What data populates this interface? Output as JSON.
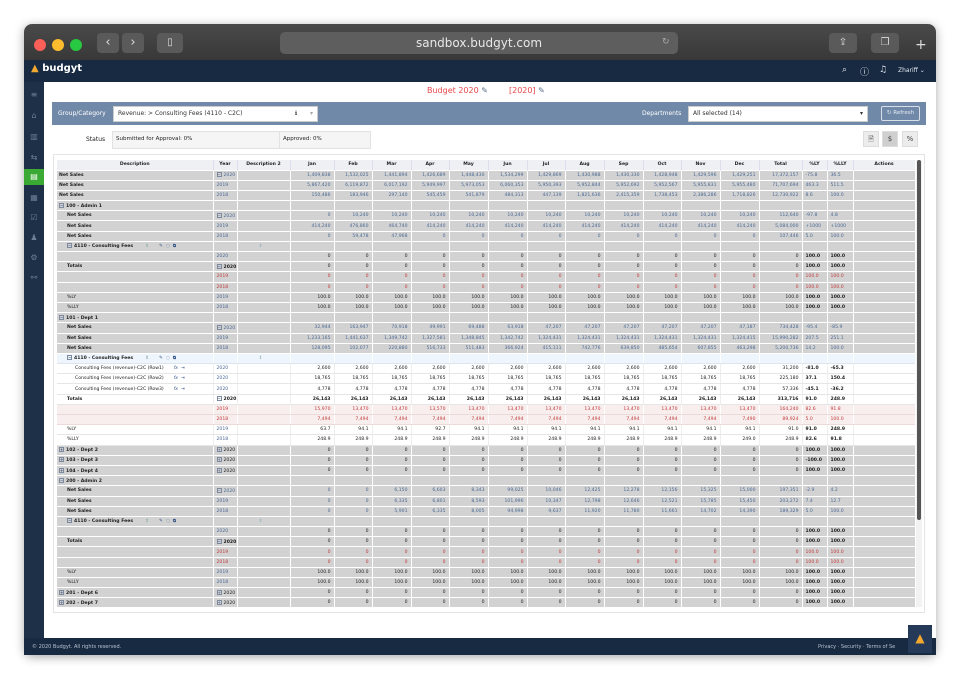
{
  "browser": {
    "url": "sandbox.budgyt.com"
  },
  "app": {
    "logo": "budgyt",
    "user": "Zhariff",
    "icons": [
      "search-icon",
      "help-icon",
      "bell-icon"
    ]
  },
  "sidebar": {
    "items": [
      "menu-icon",
      "home-icon",
      "reports-icon",
      "transfer-icon",
      "budget-icon",
      "documents-icon",
      "approvals-icon",
      "users-icon",
      "settings-icon",
      "integrations-icon"
    ],
    "active": 4,
    "active_color": "#3aaa35"
  },
  "header": {
    "budget": "Budget 2020",
    "year": "[2020]"
  },
  "filter": {
    "group_label": "Group/Category",
    "group_value": "Revenue: > Consulting Fees (4110 - C2C)",
    "departments_label": "Departments",
    "departments_value": "All selected (14)",
    "refresh": "Refresh"
  },
  "status": {
    "label": "Status",
    "submitted": "Submitted for Approval: 0%",
    "approved": "Approved: 0%",
    "buttons": [
      "$",
      "%"
    ]
  },
  "table": {
    "columns": [
      "Description",
      "Year",
      "Description 2",
      "Jan",
      "Feb",
      "Mar",
      "Apr",
      "May",
      "Jun",
      "Jul",
      "Aug",
      "Sep",
      "Oct",
      "Nov",
      "Dec",
      "Total",
      "%LY",
      "%LLY",
      "Actions"
    ],
    "rows": [
      {
        "d": "Net Sales",
        "l": 0,
        "b": 1,
        "y": "2020",
        "yt": "minus",
        "c": "blue",
        "v": [
          "1,409,838",
          "1,532,025",
          "1,441,894",
          "1,426,689",
          "1,448,430",
          "1,534,299",
          "1,429,869",
          "1,430,988",
          "1,430,330",
          "1,428,948",
          "1,429,596",
          "1,429,251"
        ],
        "t": "17,372,157",
        "ly": "-75.8",
        "lly": "36.5",
        "bg": "gray"
      },
      {
        "d": "Net Sales",
        "l": 0,
        "b": 1,
        "y": "2019",
        "c": "blue",
        "v": [
          "5,867,420",
          "6,119,872",
          "6,017,192",
          "5,949,997",
          "5,973,053",
          "6,060,353",
          "5,950,393",
          "5,952,844",
          "5,952,692",
          "5,952,567",
          "5,955,831",
          "5,955,480"
        ],
        "t": "71,707,694",
        "ly": "463.3",
        "lly": "511.5",
        "bg": "gray"
      },
      {
        "d": "Net Sales",
        "l": 0,
        "b": 1,
        "y": "2018",
        "c": "blue",
        "v": [
          "150,486",
          "183,946",
          "297,140",
          "545,459",
          "541,879",
          "484,313",
          "447,139",
          "1,821,636",
          "2,415,359",
          "1,738,453",
          "2,386,286",
          "1,718,826"
        ],
        "t": "12,730,922",
        "ly": "8.6",
        "lly": "100.0",
        "bg": "gray"
      },
      {
        "d": "100 - Admin 1",
        "l": 0,
        "b": 1,
        "tog": "minus",
        "bg": "gray"
      },
      {
        "d": "Net Sales",
        "l": 1,
        "b": 1,
        "y": "2020",
        "yt": "minus",
        "c": "blue",
        "v": [
          "0",
          "10,240",
          "10,240",
          "10,240",
          "10,240",
          "10,240",
          "10,240",
          "10,240",
          "10,240",
          "10,240",
          "10,240",
          "10,240"
        ],
        "t": "112,640",
        "ly": "-97.8",
        "lly": "4.8",
        "bg": "gray"
      },
      {
        "d": "Net Sales",
        "l": 1,
        "b": 1,
        "y": "2019",
        "c": "blue",
        "v": [
          "414,240",
          "476,860",
          "464,740",
          "414,240",
          "414,240",
          "414,240",
          "414,240",
          "414,240",
          "414,240",
          "414,240",
          "414,240",
          "414,240"
        ],
        "t": "5,084,000",
        "ly": "+1000",
        "lly": "+1000",
        "bg": "gray"
      },
      {
        "d": "Net Sales",
        "l": 1,
        "b": 1,
        "y": "2018",
        "c": "blue",
        "v": [
          "0",
          "59,478",
          "47,968",
          "0",
          "0",
          "0",
          "0",
          "0",
          "0",
          "0",
          "0",
          "0"
        ],
        "t": "107,446",
        "ly": "5.0",
        "lly": "100.0",
        "bg": "gray"
      },
      {
        "d": "4110 - Consulting Fees",
        "l": 1,
        "b": 1,
        "tog": "minus",
        "grp": 1,
        "bg": "gray"
      },
      {
        "d": "",
        "l": 1,
        "y": "2020",
        "c": "blk",
        "v": [
          "0",
          "0",
          "0",
          "0",
          "0",
          "0",
          "0",
          "0",
          "0",
          "0",
          "0",
          "0"
        ],
        "t": "0",
        "ly": "100.0",
        "lly": "100.0",
        "pb": 1,
        "bg": "gray"
      },
      {
        "d": "Totals",
        "l": 1,
        "b": 1,
        "y": "2020",
        "yt": "minus",
        "c": "blk",
        "v": [
          "0",
          "0",
          "0",
          "0",
          "0",
          "0",
          "0",
          "0",
          "0",
          "0",
          "0",
          "0"
        ],
        "t": "0",
        "ly": "100.0",
        "lly": "100.0",
        "pb": 1,
        "bg": "gray"
      },
      {
        "d": "",
        "l": 1,
        "y": "2019",
        "c": "red",
        "v": [
          "0",
          "0",
          "0",
          "0",
          "0",
          "0",
          "0",
          "0",
          "0",
          "0",
          "0",
          "0"
        ],
        "t": "0",
        "ly": "100.0",
        "lly": "100.0",
        "bg": "gray"
      },
      {
        "d": "",
        "l": 1,
        "y": "2018",
        "c": "red",
        "v": [
          "0",
          "0",
          "0",
          "0",
          "0",
          "0",
          "0",
          "0",
          "0",
          "0",
          "0",
          "0"
        ],
        "t": "0",
        "ly": "100.0",
        "lly": "100.0",
        "bg": "gray"
      },
      {
        "d": "%LY",
        "l": 1,
        "y": "2019",
        "c": "blk",
        "v": [
          "100.0",
          "100.0",
          "100.0",
          "100.0",
          "100.0",
          "100.0",
          "100.0",
          "100.0",
          "100.0",
          "100.0",
          "100.0",
          "100.0"
        ],
        "t": "100.0",
        "ly": "100.0",
        "lly": "100.0",
        "pb": 1,
        "bg": "gray"
      },
      {
        "d": "%LLY",
        "l": 1,
        "y": "2018",
        "c": "blk",
        "v": [
          "100.0",
          "100.0",
          "100.0",
          "100.0",
          "100.0",
          "100.0",
          "100.0",
          "100.0",
          "100.0",
          "100.0",
          "100.0",
          "100.0"
        ],
        "t": "100.0",
        "ly": "100.0",
        "lly": "100.0",
        "pb": 1,
        "bg": "gray"
      },
      {
        "d": "101 - Dept 1",
        "l": 0,
        "b": 1,
        "tog": "minus",
        "bg": "gray"
      },
      {
        "d": "Net Sales",
        "l": 1,
        "b": 1,
        "y": "2020",
        "yt": "minus",
        "c": "blue",
        "v": [
          "32,944",
          "163,947",
          "70,918",
          "49,991",
          "69,488",
          "63,918",
          "47,207",
          "47,207",
          "47,207",
          "47,207",
          "47,207",
          "47,187"
        ],
        "t": "734,428",
        "ly": "-95.4",
        "lly": "-85.9",
        "bg": "gray"
      },
      {
        "d": "Net Sales",
        "l": 1,
        "b": 1,
        "y": "2019",
        "c": "blue",
        "v": [
          "1,233,165",
          "1,441,637",
          "1,349,742",
          "1,327,581",
          "1,348,845",
          "1,342,742",
          "1,324,431",
          "1,324,431",
          "1,324,431",
          "1,324,431",
          "1,324,431",
          "1,324,415"
        ],
        "t": "15,990,282",
        "ly": "207.5",
        "lly": "251.1",
        "bg": "gray"
      },
      {
        "d": "Net Sales",
        "l": 1,
        "b": 1,
        "y": "2018",
        "c": "blue",
        "v": [
          "128,095",
          "102,077",
          "220,880",
          "516,733",
          "511,483",
          "366,924",
          "415,111",
          "742,776",
          "639,850",
          "485,654",
          "607,855",
          "463,298"
        ],
        "t": "5,200,736",
        "ly": "14.2",
        "lly": "100.0",
        "bg": "gray"
      },
      {
        "d": "4110 - Consulting Fees",
        "l": 1,
        "b": 1,
        "tog": "minus",
        "grp": 1,
        "bg": "lblue"
      },
      {
        "d": "Consulting Fees (revenue)-C2C (Row1)",
        "l": 2,
        "item": 1,
        "y": "2020",
        "c": "blk",
        "v": [
          "2,600",
          "2,600",
          "2,600",
          "2,600",
          "2,600",
          "2,600",
          "2,600",
          "2,600",
          "2,600",
          "2,600",
          "2,600",
          "2,600"
        ],
        "t": "31,200",
        "ly": "-81.0",
        "lly": "-65.3",
        "pb": 1,
        "bg": "white"
      },
      {
        "d": "Consulting Fees (revenue)-C2C (Row2)",
        "l": 2,
        "item": 1,
        "y": "2020",
        "c": "blk",
        "v": [
          "18,765",
          "18,765",
          "18,765",
          "18,765",
          "18,765",
          "18,765",
          "18,765",
          "18,765",
          "18,765",
          "18,765",
          "18,765",
          "18,765"
        ],
        "t": "225,180",
        "ly": "37.1",
        "lly": "150.4",
        "pb": 1,
        "bg": "white"
      },
      {
        "d": "Consulting Fees (revenue)-C2C (Row3)",
        "l": 2,
        "item": 1,
        "y": "2020",
        "c": "blk",
        "v": [
          "4,778",
          "4,778",
          "4,778",
          "4,778",
          "4,778",
          "4,778",
          "4,778",
          "4,778",
          "4,778",
          "4,778",
          "4,778",
          "4,778"
        ],
        "t": "57,336",
        "ly": "-45.1",
        "lly": "-36.2",
        "pb": 1,
        "bg": "white"
      },
      {
        "d": "Totals",
        "l": 1,
        "b": 1,
        "y": "2020",
        "yt": "minus",
        "c": "blk",
        "vb": 1,
        "v": [
          "26,143",
          "26,143",
          "26,143",
          "26,143",
          "26,143",
          "26,143",
          "26,143",
          "26,143",
          "26,143",
          "26,143",
          "26,143",
          "26,143"
        ],
        "t": "313,716",
        "ly": "91.0",
        "lly": "248.9",
        "pb": 1,
        "bg": "white"
      },
      {
        "d": "",
        "l": 1,
        "y": "2019",
        "c": "red",
        "v": [
          "15,970",
          "13,470",
          "13,470",
          "13,570",
          "13,470",
          "13,470",
          "13,470",
          "13,470",
          "13,470",
          "13,470",
          "13,470",
          "13,470"
        ],
        "t": "164,240",
        "ly": "82.6",
        "lly": "91.8",
        "bg": "pink"
      },
      {
        "d": "",
        "l": 1,
        "y": "2018",
        "c": "red",
        "v": [
          "7,494",
          "7,494",
          "7,494",
          "7,494",
          "7,494",
          "7,494",
          "7,494",
          "7,494",
          "7,494",
          "7,494",
          "7,494",
          "7,490"
        ],
        "t": "89,924",
        "ly": "5.0",
        "lly": "100.0",
        "bg": "pink"
      },
      {
        "d": "%LY",
        "l": 1,
        "y": "2019",
        "c": "blk",
        "v": [
          "63.7",
          "94.1",
          "94.1",
          "92.7",
          "94.1",
          "94.1",
          "94.1",
          "94.1",
          "94.1",
          "94.1",
          "94.1",
          "94.1"
        ],
        "t": "91.0",
        "ly": "91.0",
        "lly": "248.9",
        "pb": 1,
        "bg": "white"
      },
      {
        "d": "%LLY",
        "l": 1,
        "y": "2018",
        "c": "blk",
        "v": [
          "248.9",
          "248.9",
          "248.9",
          "248.9",
          "248.9",
          "248.9",
          "248.9",
          "248.9",
          "248.9",
          "248.9",
          "248.9",
          "249.0"
        ],
        "t": "248.9",
        "ly": "82.6",
        "lly": "91.8",
        "pb": 1,
        "bg": "white"
      },
      {
        "d": "102 - Dept 2",
        "l": 0,
        "b": 1,
        "tog": "plus",
        "y": "2020",
        "yt": "plus",
        "c": "blk",
        "v": [
          "0",
          "0",
          "0",
          "0",
          "0",
          "0",
          "0",
          "0",
          "0",
          "0",
          "0",
          "0"
        ],
        "t": "0",
        "ly": "100.0",
        "lly": "100.0",
        "pb": 1,
        "bg": "gray"
      },
      {
        "d": "103 - Dept 3",
        "l": 0,
        "b": 1,
        "tog": "plus",
        "y": "2020",
        "yt": "plus",
        "c": "blk",
        "v": [
          "0",
          "0",
          "0",
          "0",
          "0",
          "0",
          "0",
          "0",
          "0",
          "0",
          "0",
          "0"
        ],
        "t": "0",
        "ly": "-100.0",
        "lly": "100.0",
        "pb": 1,
        "bg": "gray"
      },
      {
        "d": "104 - Dept 4",
        "l": 0,
        "b": 1,
        "tog": "plus",
        "y": "2020",
        "yt": "plus",
        "c": "blk",
        "v": [
          "0",
          "0",
          "0",
          "0",
          "0",
          "0",
          "0",
          "0",
          "0",
          "0",
          "0",
          "0"
        ],
        "t": "0",
        "ly": "100.0",
        "lly": "100.0",
        "pb": 1,
        "bg": "gray"
      },
      {
        "d": "200 - Admin 2",
        "l": 0,
        "b": 1,
        "tog": "minus",
        "bg": "gray"
      },
      {
        "d": "Net Sales",
        "l": 1,
        "b": 1,
        "y": "2020",
        "yt": "minus",
        "c": "blue",
        "v": [
          "0",
          "0",
          "6,150",
          "6,603",
          "8,343",
          "99,025",
          "10,046",
          "12,425",
          "12,278",
          "12,156",
          "15,325",
          "15,000"
        ],
        "t": "197,351",
        "ly": "-2.9",
        "lly": "4.2",
        "bg": "gray"
      },
      {
        "d": "Net Sales",
        "l": 1,
        "b": 1,
        "y": "2019",
        "c": "blue",
        "v": [
          "0",
          "0",
          "6,335",
          "6,801",
          "8,593",
          "101,996",
          "10,347",
          "12,798",
          "12,646",
          "12,521",
          "15,785",
          "15,450"
        ],
        "t": "203,272",
        "ly": "7.4",
        "lly": "12.7",
        "bg": "gray"
      },
      {
        "d": "Net Sales",
        "l": 1,
        "b": 1,
        "y": "2018",
        "c": "blue",
        "v": [
          "0",
          "0",
          "5,901",
          "6,335",
          "8,005",
          "94,998",
          "9,637",
          "11,920",
          "11,780",
          "11,661",
          "14,702",
          "14,390"
        ],
        "t": "189,329",
        "ly": "5.0",
        "lly": "100.0",
        "bg": "gray"
      },
      {
        "d": "4110 - Consulting Fees",
        "l": 1,
        "b": 1,
        "tog": "minus",
        "grp": 1,
        "bg": "gray"
      },
      {
        "d": "",
        "l": 1,
        "y": "2020",
        "c": "blk",
        "v": [
          "0",
          "0",
          "0",
          "0",
          "0",
          "0",
          "0",
          "0",
          "0",
          "0",
          "0",
          "0"
        ],
        "t": "0",
        "ly": "100.0",
        "lly": "100.0",
        "pb": 1,
        "bg": "gray"
      },
      {
        "d": "Totals",
        "l": 1,
        "b": 1,
        "y": "2020",
        "yt": "minus",
        "c": "blk",
        "v": [
          "0",
          "0",
          "0",
          "0",
          "0",
          "0",
          "0",
          "0",
          "0",
          "0",
          "0",
          "0"
        ],
        "t": "0",
        "ly": "100.0",
        "lly": "100.0",
        "pb": 1,
        "bg": "gray"
      },
      {
        "d": "",
        "l": 1,
        "y": "2019",
        "c": "red",
        "v": [
          "0",
          "0",
          "0",
          "0",
          "0",
          "0",
          "0",
          "0",
          "0",
          "0",
          "0",
          "0"
        ],
        "t": "0",
        "ly": "100.0",
        "lly": "100.0",
        "bg": "gray"
      },
      {
        "d": "",
        "l": 1,
        "y": "2018",
        "c": "red",
        "v": [
          "0",
          "0",
          "0",
          "0",
          "0",
          "0",
          "0",
          "0",
          "0",
          "0",
          "0",
          "0"
        ],
        "t": "0",
        "ly": "100.0",
        "lly": "100.0",
        "bg": "gray"
      },
      {
        "d": "%LY",
        "l": 1,
        "y": "2019",
        "c": "blk",
        "v": [
          "100.0",
          "100.0",
          "100.0",
          "100.0",
          "100.0",
          "100.0",
          "100.0",
          "100.0",
          "100.0",
          "100.0",
          "100.0",
          "100.0"
        ],
        "t": "100.0",
        "ly": "100.0",
        "lly": "100.0",
        "pb": 1,
        "bg": "gray"
      },
      {
        "d": "%LLY",
        "l": 1,
        "y": "2018",
        "c": "blk",
        "v": [
          "100.0",
          "100.0",
          "100.0",
          "100.0",
          "100.0",
          "100.0",
          "100.0",
          "100.0",
          "100.0",
          "100.0",
          "100.0",
          "100.0"
        ],
        "t": "100.0",
        "ly": "100.0",
        "lly": "100.0",
        "pb": 1,
        "bg": "gray"
      },
      {
        "d": "201 - Dept 6",
        "l": 0,
        "b": 1,
        "tog": "plus",
        "y": "2020",
        "yt": "plus",
        "c": "blk",
        "v": [
          "0",
          "0",
          "0",
          "0",
          "0",
          "0",
          "0",
          "0",
          "0",
          "0",
          "0",
          "0"
        ],
        "t": "0",
        "ly": "100.0",
        "lly": "100.0",
        "pb": 1,
        "bg": "gray"
      },
      {
        "d": "202 - Dept 7",
        "l": 0,
        "b": 1,
        "tog": "plus",
        "y": "2020",
        "yt": "plus",
        "c": "blk",
        "v": [
          "0",
          "0",
          "0",
          "0",
          "0",
          "0",
          "0",
          "0",
          "0",
          "0",
          "0",
          "0"
        ],
        "t": "0",
        "ly": "100.0",
        "lly": "100.0",
        "pb": 1,
        "bg": "gray"
      }
    ]
  },
  "footer": {
    "copyright": "© 2020 Budgyt. All rights reserved.",
    "links": [
      "Privacy",
      "Security",
      "Terms of Se"
    ]
  }
}
